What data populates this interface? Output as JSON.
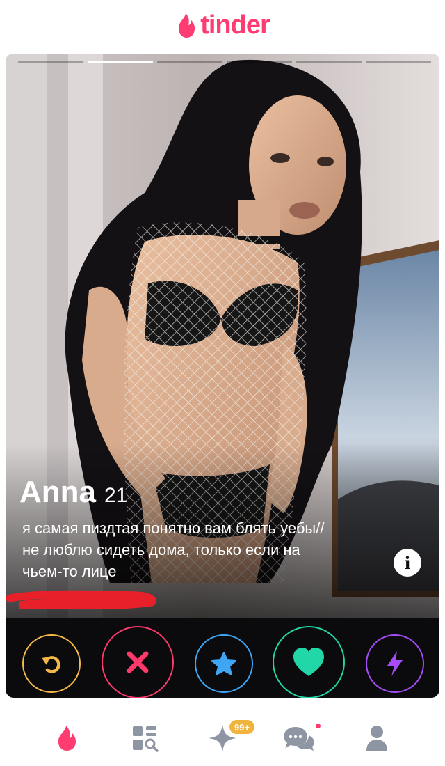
{
  "app": {
    "logo_text": "tinder",
    "brand_color": "#fe3c72"
  },
  "card": {
    "photo_count": 6,
    "active_photo": 2,
    "name": "Anna",
    "age": "21",
    "bio": [
      "я самая пиздтая понятно вам блять уебы//",
      "не люблю сидеть дома, только если на",
      "чьем-то лице"
    ],
    "info_icon": "i"
  },
  "actions": [
    {
      "name": "rewind-button",
      "icon": "rewind-icon",
      "color": "#f5b748"
    },
    {
      "name": "nope-button",
      "icon": "close-icon",
      "color": "#fd3a6b"
    },
    {
      "name": "super-like-button",
      "icon": "star-icon",
      "color": "#3ea6f5"
    },
    {
      "name": "like-button",
      "icon": "heart-icon",
      "color": "#21d6a7"
    },
    {
      "name": "boost-button",
      "icon": "lightning-icon",
      "color": "#a64df7"
    }
  ],
  "tabs": {
    "badge_count": "99+",
    "items": [
      "flame-icon",
      "explore-icon",
      "spark-icon",
      "chat-icon",
      "profile-icon"
    ]
  }
}
